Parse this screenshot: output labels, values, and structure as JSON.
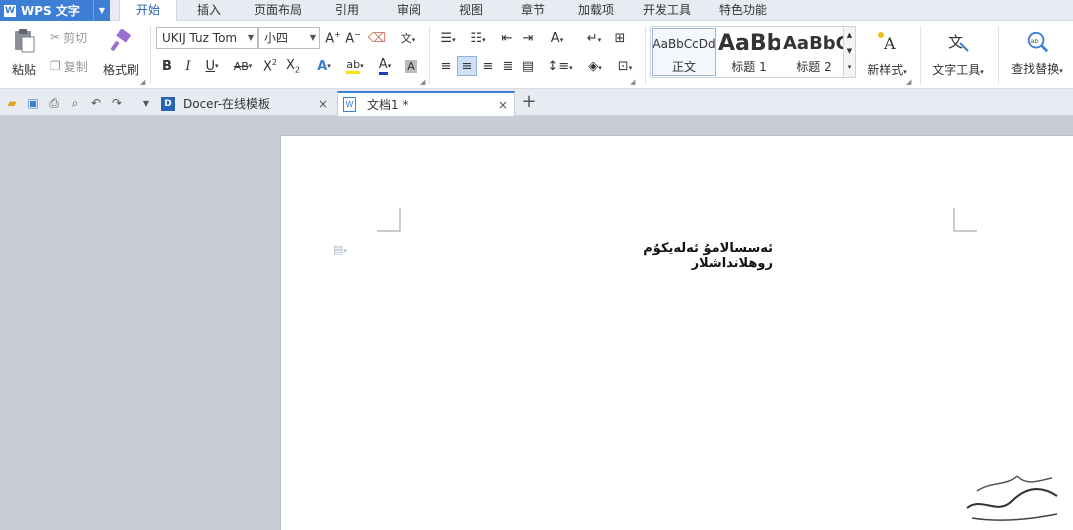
{
  "app": {
    "name": "WPS 文字"
  },
  "menu": [
    "开始",
    "插入",
    "页面布局",
    "引用",
    "审阅",
    "视图",
    "章节",
    "加载项",
    "开发工具",
    "特色功能"
  ],
  "active_menu": "开始",
  "clipboard": {
    "paste": "粘贴",
    "cut": "剪切",
    "copy": "复制",
    "format_painter": "格式刷"
  },
  "font": {
    "name": "UKIJ Tuz Tom",
    "size": "小四"
  },
  "styles": [
    {
      "preview": "AaBbCcDd",
      "name": "正文"
    },
    {
      "preview": "AaBb",
      "name": "标题 1"
    },
    {
      "preview": "AaBbC",
      "name": "标题 2"
    }
  ],
  "new_style": "新样式",
  "text_tool": "文字工具",
  "find_replace": "查找替换",
  "tabs": [
    {
      "title": "Docer-在线模板"
    },
    {
      "title": "文档1 *"
    }
  ],
  "document": {
    "text": "ئەسسالامۇ ئەلەيكۇم  روھلانداشلار"
  },
  "colors": {
    "accent": "#3d7fd4",
    "font_color": "#1a3fb0",
    "highlight": "#f5e400"
  }
}
